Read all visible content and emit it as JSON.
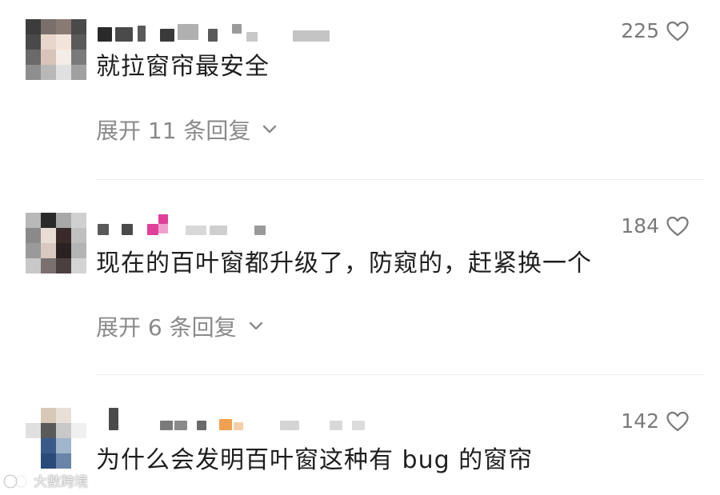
{
  "comments": [
    {
      "text": "就拉窗帘最安全",
      "likes": "225",
      "replies_label": "展开 11 条回复"
    },
    {
      "text": "现在的百叶窗都升级了，防窥的，赶紧换一个",
      "likes": "184",
      "replies_label": "展开 6 条回复"
    },
    {
      "text": "为什么会发明百叶窗这种有 bug 的窗帘",
      "likes": "142"
    }
  ],
  "watermark": {
    "text": "大數跨境"
  },
  "icons": {
    "like": "heart-outline-icon",
    "expand": "chevron-down-icon",
    "watermark": "watermark-logo-icon"
  },
  "colors": {
    "text": "#1e1e1e",
    "muted": "#8a8a8a",
    "like_count": "#7a7a7a",
    "divider": "#ececec",
    "pink_blur": "#e0409a",
    "orange_blur": "#f0a050"
  }
}
